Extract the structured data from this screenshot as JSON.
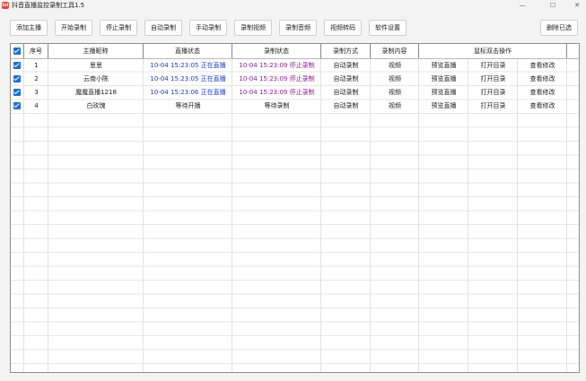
{
  "window": {
    "title": "抖音直播监控录制工具1.5",
    "app_icon_text": "lol",
    "minimize": "—",
    "maximize": "☐",
    "close": "✕"
  },
  "toolbar": {
    "add_streamer": "添加主播",
    "start_record": "开始录制",
    "stop_record": "停止录制",
    "auto_record": "自动录制",
    "manual_record": "手动录制",
    "record_video": "录制视频",
    "record_audio": "录制音频",
    "video_transcode": "视频转码",
    "software_settings": "软件设置",
    "delete_selected": "删除已选"
  },
  "table": {
    "headers": {
      "index": "序号",
      "nickname": "主播昵称",
      "live_status": "直播状态",
      "record_status": "录制状态",
      "record_mode": "录制方式",
      "record_content": "录制内容",
      "mouse_actions": "鼠标双击操作"
    },
    "rows": [
      {
        "index": "1",
        "nickname": "思思",
        "live_time": "10-04 15:23:05",
        "live_state": "正在直播",
        "rec_time": "10-04 15:23:09",
        "rec_state": "停止录制",
        "mode": "自动录制",
        "content": "视频",
        "a1": "预览直播",
        "a2": "打开目录",
        "a3": "查看修改"
      },
      {
        "index": "2",
        "nickname": "云南小陈",
        "live_time": "10-04 15:23:05",
        "live_state": "正在直播",
        "rec_time": "10-04 15:23:09",
        "rec_state": "停止录制",
        "mode": "自动录制",
        "content": "视频",
        "a1": "预览直播",
        "a2": "打开目录",
        "a3": "查看修改"
      },
      {
        "index": "3",
        "nickname": "魔魔直播1218",
        "live_time": "10-04 15:23:06",
        "live_state": "正在直播",
        "rec_time": "10-04 15:23:09",
        "rec_state": "停止录制",
        "mode": "自动录制",
        "content": "视频",
        "a1": "预览直播",
        "a2": "打开目录",
        "a3": "查看修改"
      },
      {
        "index": "4",
        "nickname": "白玫瑰",
        "live_status_text": "等待开播",
        "rec_status_text": "等待录制",
        "mode": "自动录制",
        "content": "视频",
        "a1": "预览直播",
        "a2": "打开目录",
        "a3": "查看修改"
      }
    ]
  },
  "colors": {
    "checkbox": "#1a6fcf",
    "live_blue": "#1f3cc8",
    "record_purple": "#8a1f8f"
  }
}
